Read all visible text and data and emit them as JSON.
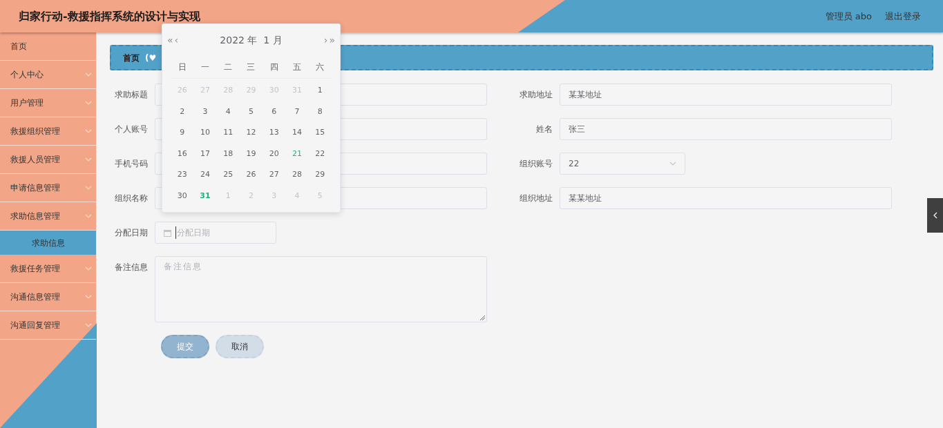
{
  "header": {
    "title": "归家行动-救援指挥系统的设计与实现",
    "user": "管理员 abo",
    "logout": "退出登录"
  },
  "sidebar": {
    "items": [
      {
        "label": "首页",
        "has_arrow": false
      },
      {
        "label": "个人中心",
        "has_arrow": true
      },
      {
        "label": "用户管理",
        "has_arrow": true
      },
      {
        "label": "救援组织管理",
        "has_arrow": true
      },
      {
        "label": "救援人员管理",
        "has_arrow": true
      },
      {
        "label": "申请信息管理",
        "has_arrow": true
      },
      {
        "label": "求助信息管理",
        "has_arrow": true,
        "children": [
          {
            "label": "求助信息",
            "selected": true
          }
        ]
      },
      {
        "label": "救援任务管理",
        "has_arrow": true
      },
      {
        "label": "沟通信息管理",
        "has_arrow": true
      },
      {
        "label": "沟通回复管理",
        "has_arrow": true
      }
    ]
  },
  "breadcrumb": {
    "home": "首页",
    "decoration": "(♥"
  },
  "form": {
    "rows": [
      [
        {
          "label": "求助标题",
          "kind": "input"
        },
        {
          "label": "求助地址",
          "kind": "input",
          "value": "某某地址"
        }
      ],
      [
        {
          "label": "个人账号",
          "kind": "input"
        },
        {
          "label": "姓名",
          "kind": "input",
          "value": "张三"
        }
      ],
      [
        {
          "label": "手机号码",
          "kind": "input"
        },
        {
          "label": "组织账号",
          "kind": "select",
          "value": "22"
        }
      ],
      [
        {
          "label": "组织名称",
          "kind": "input"
        },
        {
          "label": "组织地址",
          "kind": "input",
          "value": "某某地址"
        }
      ],
      [
        {
          "label": "分配日期",
          "kind": "date",
          "placeholder": "分配日期"
        }
      ],
      [
        {
          "label": "备注信息",
          "kind": "textarea",
          "placeholder": "备注信息"
        }
      ]
    ],
    "buttons": [
      {
        "label": "提交",
        "kind": "primary"
      },
      {
        "label": "取消",
        "kind": "secondary"
      }
    ]
  },
  "calendar": {
    "prev_year": "«",
    "prev_month": "‹",
    "title": "2022 年  1 月",
    "next_month": "›",
    "next_year": "»",
    "weekdays": [
      "日",
      "一",
      "二",
      "三",
      "四",
      "五",
      "六"
    ],
    "weeks": [
      [
        {
          "day": "26",
          "kind": "other"
        },
        {
          "day": "27",
          "kind": "other"
        },
        {
          "day": "28",
          "kind": "other"
        },
        {
          "day": "29",
          "kind": "other"
        },
        {
          "day": "30",
          "kind": "other"
        },
        {
          "day": "31",
          "kind": "other"
        },
        {
          "day": "1",
          "kind": "current"
        }
      ],
      [
        {
          "day": "2",
          "kind": "current"
        },
        {
          "day": "3",
          "kind": "current"
        },
        {
          "day": "4",
          "kind": "current"
        },
        {
          "day": "5",
          "kind": "current"
        },
        {
          "day": "6",
          "kind": "current"
        },
        {
          "day": "7",
          "kind": "current"
        },
        {
          "day": "8",
          "kind": "current"
        }
      ],
      [
        {
          "day": "9",
          "kind": "current"
        },
        {
          "day": "10",
          "kind": "current"
        },
        {
          "day": "11",
          "kind": "current"
        },
        {
          "day": "12",
          "kind": "current"
        },
        {
          "day": "13",
          "kind": "current"
        },
        {
          "day": "14",
          "kind": "current"
        },
        {
          "day": "15",
          "kind": "current"
        }
      ],
      [
        {
          "day": "16",
          "kind": "current"
        },
        {
          "day": "17",
          "kind": "current"
        },
        {
          "day": "18",
          "kind": "current"
        },
        {
          "day": "19",
          "kind": "current"
        },
        {
          "day": "20",
          "kind": "current"
        },
        {
          "day": "21",
          "kind": "highlight"
        },
        {
          "day": "22",
          "kind": "current"
        }
      ],
      [
        {
          "day": "23",
          "kind": "current"
        },
        {
          "day": "24",
          "kind": "current"
        },
        {
          "day": "25",
          "kind": "current"
        },
        {
          "day": "26",
          "kind": "current"
        },
        {
          "day": "27",
          "kind": "current"
        },
        {
          "day": "28",
          "kind": "current"
        },
        {
          "day": "29",
          "kind": "current"
        }
      ],
      [
        {
          "day": "30",
          "kind": "current"
        },
        {
          "day": "31",
          "kind": "today"
        },
        {
          "day": "1",
          "kind": "other"
        },
        {
          "day": "2",
          "kind": "other"
        },
        {
          "day": "3",
          "kind": "other"
        },
        {
          "day": "4",
          "kind": "other"
        },
        {
          "day": "5",
          "kind": "other"
        }
      ]
    ]
  }
}
